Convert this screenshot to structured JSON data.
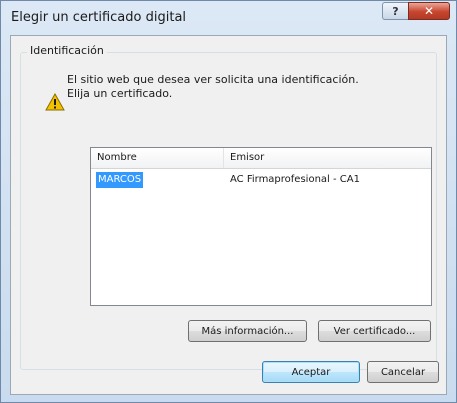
{
  "window": {
    "title": "Elegir un certificado digital",
    "help_label": "?",
    "close_label": "✕"
  },
  "group": {
    "title": "Identificación",
    "message_line1": "El sitio web que desea ver solicita una identificación.",
    "message_line2": "Elija un certificado."
  },
  "list": {
    "columns": [
      "Nombre",
      "Emisor"
    ],
    "rows": [
      {
        "name": "MARCOS",
        "issuer": "AC Firmaprofesional - CA1",
        "selected": true
      }
    ]
  },
  "buttons": {
    "more_info": "Más información...",
    "view_certificate": "Ver certificado...",
    "accept": "Aceptar",
    "cancel": "Cancelar"
  },
  "colors": {
    "selection": "#3399ff",
    "close_button": "#c7452f",
    "warning_icon": "#f2c200"
  },
  "icons": {
    "warning": "warning-icon"
  }
}
